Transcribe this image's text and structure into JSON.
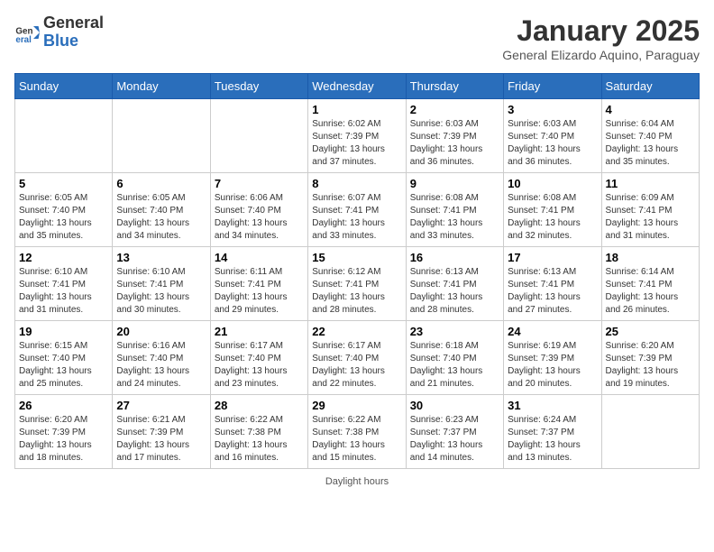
{
  "header": {
    "logo_general": "General",
    "logo_blue": "Blue",
    "month_title": "January 2025",
    "subtitle": "General Elizardo Aquino, Paraguay"
  },
  "weekdays": [
    "Sunday",
    "Monday",
    "Tuesday",
    "Wednesday",
    "Thursday",
    "Friday",
    "Saturday"
  ],
  "weeks": [
    [
      {
        "day": "",
        "info": ""
      },
      {
        "day": "",
        "info": ""
      },
      {
        "day": "",
        "info": ""
      },
      {
        "day": "1",
        "info": "Sunrise: 6:02 AM\nSunset: 7:39 PM\nDaylight: 13 hours and 37 minutes."
      },
      {
        "day": "2",
        "info": "Sunrise: 6:03 AM\nSunset: 7:39 PM\nDaylight: 13 hours and 36 minutes."
      },
      {
        "day": "3",
        "info": "Sunrise: 6:03 AM\nSunset: 7:40 PM\nDaylight: 13 hours and 36 minutes."
      },
      {
        "day": "4",
        "info": "Sunrise: 6:04 AM\nSunset: 7:40 PM\nDaylight: 13 hours and 35 minutes."
      }
    ],
    [
      {
        "day": "5",
        "info": "Sunrise: 6:05 AM\nSunset: 7:40 PM\nDaylight: 13 hours and 35 minutes."
      },
      {
        "day": "6",
        "info": "Sunrise: 6:05 AM\nSunset: 7:40 PM\nDaylight: 13 hours and 34 minutes."
      },
      {
        "day": "7",
        "info": "Sunrise: 6:06 AM\nSunset: 7:40 PM\nDaylight: 13 hours and 34 minutes."
      },
      {
        "day": "8",
        "info": "Sunrise: 6:07 AM\nSunset: 7:41 PM\nDaylight: 13 hours and 33 minutes."
      },
      {
        "day": "9",
        "info": "Sunrise: 6:08 AM\nSunset: 7:41 PM\nDaylight: 13 hours and 33 minutes."
      },
      {
        "day": "10",
        "info": "Sunrise: 6:08 AM\nSunset: 7:41 PM\nDaylight: 13 hours and 32 minutes."
      },
      {
        "day": "11",
        "info": "Sunrise: 6:09 AM\nSunset: 7:41 PM\nDaylight: 13 hours and 31 minutes."
      }
    ],
    [
      {
        "day": "12",
        "info": "Sunrise: 6:10 AM\nSunset: 7:41 PM\nDaylight: 13 hours and 31 minutes."
      },
      {
        "day": "13",
        "info": "Sunrise: 6:10 AM\nSunset: 7:41 PM\nDaylight: 13 hours and 30 minutes."
      },
      {
        "day": "14",
        "info": "Sunrise: 6:11 AM\nSunset: 7:41 PM\nDaylight: 13 hours and 29 minutes."
      },
      {
        "day": "15",
        "info": "Sunrise: 6:12 AM\nSunset: 7:41 PM\nDaylight: 13 hours and 28 minutes."
      },
      {
        "day": "16",
        "info": "Sunrise: 6:13 AM\nSunset: 7:41 PM\nDaylight: 13 hours and 28 minutes."
      },
      {
        "day": "17",
        "info": "Sunrise: 6:13 AM\nSunset: 7:41 PM\nDaylight: 13 hours and 27 minutes."
      },
      {
        "day": "18",
        "info": "Sunrise: 6:14 AM\nSunset: 7:41 PM\nDaylight: 13 hours and 26 minutes."
      }
    ],
    [
      {
        "day": "19",
        "info": "Sunrise: 6:15 AM\nSunset: 7:40 PM\nDaylight: 13 hours and 25 minutes."
      },
      {
        "day": "20",
        "info": "Sunrise: 6:16 AM\nSunset: 7:40 PM\nDaylight: 13 hours and 24 minutes."
      },
      {
        "day": "21",
        "info": "Sunrise: 6:17 AM\nSunset: 7:40 PM\nDaylight: 13 hours and 23 minutes."
      },
      {
        "day": "22",
        "info": "Sunrise: 6:17 AM\nSunset: 7:40 PM\nDaylight: 13 hours and 22 minutes."
      },
      {
        "day": "23",
        "info": "Sunrise: 6:18 AM\nSunset: 7:40 PM\nDaylight: 13 hours and 21 minutes."
      },
      {
        "day": "24",
        "info": "Sunrise: 6:19 AM\nSunset: 7:39 PM\nDaylight: 13 hours and 20 minutes."
      },
      {
        "day": "25",
        "info": "Sunrise: 6:20 AM\nSunset: 7:39 PM\nDaylight: 13 hours and 19 minutes."
      }
    ],
    [
      {
        "day": "26",
        "info": "Sunrise: 6:20 AM\nSunset: 7:39 PM\nDaylight: 13 hours and 18 minutes."
      },
      {
        "day": "27",
        "info": "Sunrise: 6:21 AM\nSunset: 7:39 PM\nDaylight: 13 hours and 17 minutes."
      },
      {
        "day": "28",
        "info": "Sunrise: 6:22 AM\nSunset: 7:38 PM\nDaylight: 13 hours and 16 minutes."
      },
      {
        "day": "29",
        "info": "Sunrise: 6:22 AM\nSunset: 7:38 PM\nDaylight: 13 hours and 15 minutes."
      },
      {
        "day": "30",
        "info": "Sunrise: 6:23 AM\nSunset: 7:37 PM\nDaylight: 13 hours and 14 minutes."
      },
      {
        "day": "31",
        "info": "Sunrise: 6:24 AM\nSunset: 7:37 PM\nDaylight: 13 hours and 13 minutes."
      },
      {
        "day": "",
        "info": ""
      }
    ]
  ],
  "footer": {
    "daylight_label": "Daylight hours"
  }
}
